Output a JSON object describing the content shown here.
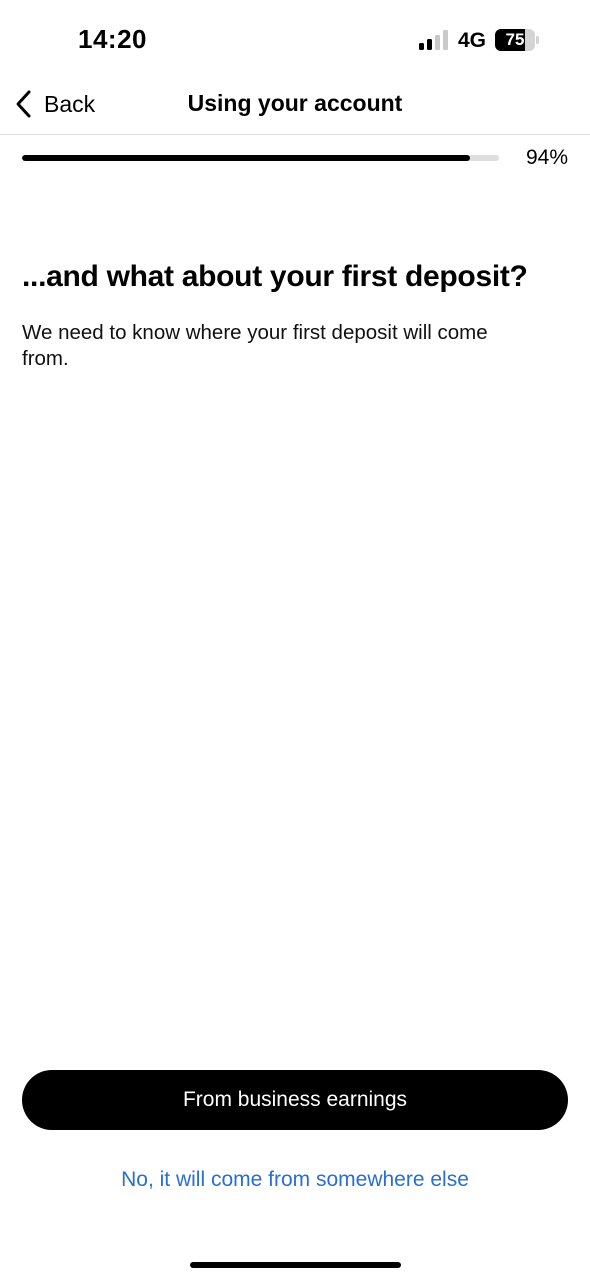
{
  "status_bar": {
    "time": "14:20",
    "network": "4G",
    "battery_level": "75",
    "battery_fraction": 0.75,
    "signal_bars_active": 2,
    "signal_bars_total": 4
  },
  "nav": {
    "back_label": "Back",
    "title": "Using your account",
    "back_icon": "chevron-left-icon"
  },
  "progress": {
    "label": "94%",
    "fraction": 0.94
  },
  "content": {
    "heading": "...and what about your first deposit?",
    "subtitle": "We need to know where your first deposit will come from."
  },
  "actions": {
    "primary_label": "From business earnings",
    "secondary_label": "No, it will come from somewhere else"
  },
  "colors": {
    "accent_link": "#2a6fd0",
    "primary_button": "#000000",
    "progress_fill": "#000000",
    "progress_track": "#dedede"
  }
}
